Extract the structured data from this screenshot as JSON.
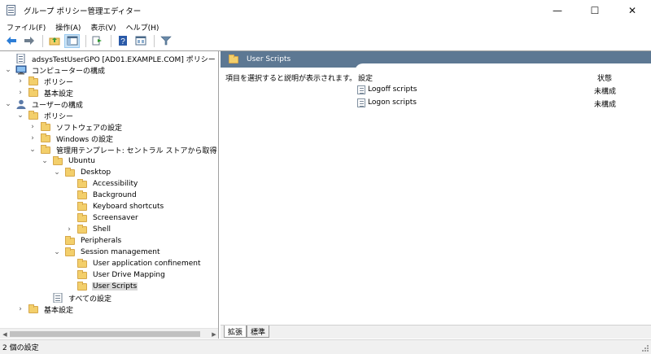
{
  "window": {
    "title": "グループ ポリシー管理エディター",
    "controls": {
      "minimize": "—",
      "maximize": "☐",
      "close": "✕"
    }
  },
  "menu": [
    "ファイル(F)",
    "操作(A)",
    "表示(V)",
    "ヘルプ(H)"
  ],
  "toolbar": {
    "buttons": [
      "back-arrow-icon",
      "forward-arrow-icon",
      "up-folder-icon",
      "show-hide-tree-icon",
      "export-list-icon",
      "help-icon",
      "properties-icon",
      "filter-icon"
    ],
    "active": "show-hide-tree-icon"
  },
  "tree": [
    {
      "label": "adsysTestUserGPO [AD01.EXAMPLE.COM] ポリシー",
      "level": 0,
      "expander": "none",
      "icon": "gpo-document-icon"
    },
    {
      "label": "コンピューターの構成",
      "level": 0,
      "expander": "expanded",
      "icon": "computer-icon"
    },
    {
      "label": "ポリシー",
      "level": 1,
      "expander": "collapsed",
      "icon": "folder-icon"
    },
    {
      "label": "基本設定",
      "level": 1,
      "expander": "collapsed",
      "icon": "folder-icon"
    },
    {
      "label": "ユーザーの構成",
      "level": 0,
      "expander": "expanded",
      "icon": "user-icon"
    },
    {
      "label": "ポリシー",
      "level": 1,
      "expander": "expanded",
      "icon": "folder-icon"
    },
    {
      "label": "ソフトウェアの設定",
      "level": 2,
      "expander": "collapsed",
      "icon": "folder-icon"
    },
    {
      "label": "Windows の設定",
      "level": 2,
      "expander": "collapsed",
      "icon": "folder-icon"
    },
    {
      "label": "管理用テンプレート: セントラル ストアから取得したポリシー",
      "level": 2,
      "expander": "expanded",
      "icon": "folder-icon"
    },
    {
      "label": "Ubuntu",
      "level": 3,
      "expander": "expanded",
      "icon": "folder-icon"
    },
    {
      "label": "Desktop",
      "level": 4,
      "expander": "expanded",
      "icon": "folder-icon"
    },
    {
      "label": "Accessibility",
      "level": 5,
      "expander": "none",
      "icon": "folder-icon"
    },
    {
      "label": "Background",
      "level": 5,
      "expander": "none",
      "icon": "folder-icon"
    },
    {
      "label": "Keyboard shortcuts",
      "level": 5,
      "expander": "none",
      "icon": "folder-icon"
    },
    {
      "label": "Screensaver",
      "level": 5,
      "expander": "none",
      "icon": "folder-icon"
    },
    {
      "label": "Shell",
      "level": 5,
      "expander": "collapsed",
      "icon": "folder-icon"
    },
    {
      "label": "Peripherals",
      "level": 4,
      "expander": "none",
      "icon": "folder-icon"
    },
    {
      "label": "Session management",
      "level": 4,
      "expander": "expanded",
      "icon": "folder-icon"
    },
    {
      "label": "User application confinement",
      "level": 5,
      "expander": "none",
      "icon": "folder-icon"
    },
    {
      "label": "User Drive Mapping",
      "level": 5,
      "expander": "none",
      "icon": "folder-icon"
    },
    {
      "label": "User Scripts",
      "level": 5,
      "expander": "none",
      "icon": "folder-icon",
      "selected": true
    },
    {
      "label": "すべての設定",
      "level": 3,
      "expander": "none",
      "icon": "all-settings-icon"
    },
    {
      "label": "基本設定",
      "level": 1,
      "expander": "collapsed",
      "icon": "folder-icon"
    }
  ],
  "right_pane": {
    "header": "User Scripts",
    "description": "項目を選択すると説明が表示されます。",
    "columns": {
      "setting": "設定",
      "state": "状態"
    },
    "rows": [
      {
        "name": "Logoff scripts",
        "state": "未構成",
        "icon": "policy-setting-icon"
      },
      {
        "name": "Logon scripts",
        "state": "未構成",
        "icon": "policy-setting-icon"
      }
    ]
  },
  "tabs": [
    {
      "label": "拡張",
      "active": true
    },
    {
      "label": "標準",
      "active": false
    }
  ],
  "status": "2 個の設定",
  "colors": {
    "header_bg": "#5d7893",
    "folder": "#f3cf6b",
    "selection": "#d9d9d9"
  }
}
